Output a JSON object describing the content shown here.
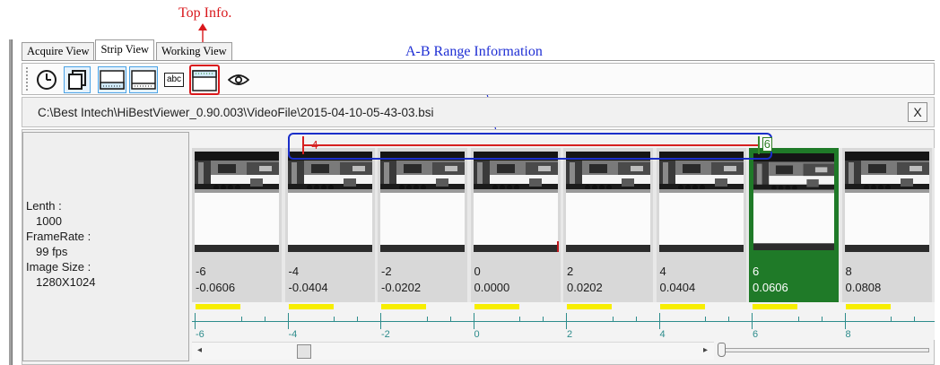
{
  "annotations": {
    "top_info": "Top Info.",
    "ab_range": "A-B Range Information",
    "annotation_red": "#d9181c",
    "annotation_blue": "#1f2fd4"
  },
  "tabs": [
    {
      "label": "Acquire View",
      "active": false
    },
    {
      "label": "Strip View",
      "active": true
    },
    {
      "label": "Working View",
      "active": false
    }
  ],
  "toolbar": {
    "icons": [
      "clock-icon",
      "copy-frames-icon",
      "bottom-info-icon",
      "bottom-info-alt-icon",
      "abc-text-icon",
      "top-info-icon",
      "eye-icon"
    ],
    "text_icon_label": "abc"
  },
  "path": {
    "text": "C:\\Best Intech\\HiBestViewer_0.90.003\\VideoFile\\2015-04-10-05-43-03.bsi",
    "close_label": "X"
  },
  "info": {
    "length_label": "Lenth :",
    "length_value": "1000",
    "framerate_label": "FrameRate :",
    "framerate_value": "99 fps",
    "size_label": "Image Size :",
    "size_value": "1280X1024"
  },
  "range": {
    "a_label": "-4",
    "b_label": "6",
    "a_color": "#d62020",
    "b_color": "#2e7d22"
  },
  "frames": [
    {
      "index": "-6",
      "time": "-0.0606"
    },
    {
      "index": "-4",
      "time": "-0.0404"
    },
    {
      "index": "-2",
      "time": "-0.0202"
    },
    {
      "index": "0",
      "time": "0.0000"
    },
    {
      "index": "2",
      "time": "0.0202"
    },
    {
      "index": "4",
      "time": "0.0404"
    },
    {
      "index": "6",
      "time": "0.0606"
    },
    {
      "index": "8",
      "time": "0.0808"
    }
  ],
  "selected_frame": "6",
  "selected_color": "#1f7a28",
  "ruler": {
    "labels": [
      "-6",
      "-4",
      "-2",
      "0",
      "2",
      "4",
      "6",
      "8"
    ],
    "bar_color": "#f7ee00",
    "axis_color": "#2d8c8c"
  },
  "scrollbar": {
    "left_arrow": "◂",
    "right_arrow": "▸"
  }
}
